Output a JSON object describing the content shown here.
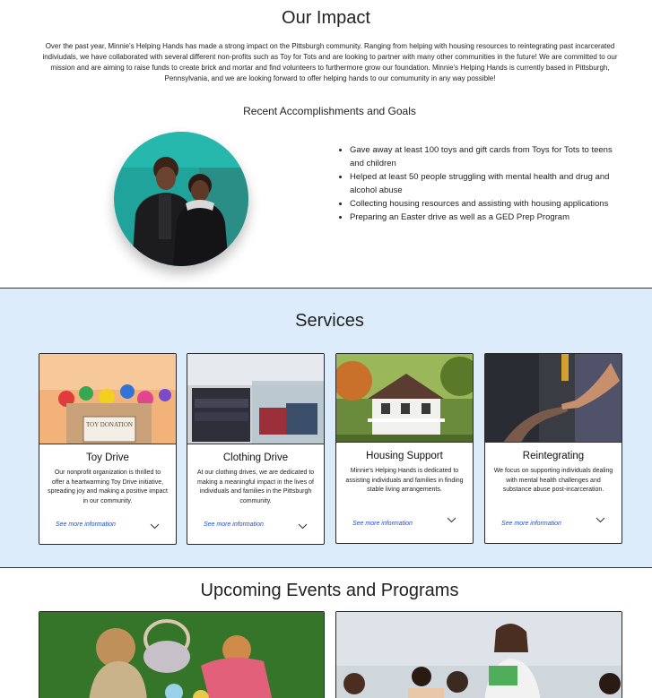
{
  "impact": {
    "title": "Our Impact",
    "intro": "Over the past year, Minnie's Helping Hands has made a strong impact on the Pittsburgh community. Ranging from helping with housing resources to reintegrating past incarcerated indiviudals, we have collaborated with several different non-profits such as Toy for Tots and are looking to partner with many other communities in the future! We are committed to our mission and are aiming to raise funds to create brick and mortar and find volunteers to furthermore grow our foundation. Minnie's Helping Hands is currently based in Pittsburgh, Pennsylvania, and we are looking forward to offer helping hands to our comumunity in any way possible!",
    "subtitle": "Recent Accomplishments and Goals",
    "goals": [
      "Gave away at least 100 toys and gift cards from Toys for Tots to teens and children",
      "Helped at least 50 people struggling with mental health and drug and alcohol abuse",
      "Collecting housing resources and assisting with housing applications",
      "Preparing an Easter drive as well as a GED Prep Program"
    ]
  },
  "services": {
    "title": "Services",
    "cards": [
      {
        "title": "Toy Drive",
        "description": "Our nonprofit organization is thrilled to offer a heartwarming Toy Drive initiative, spreading joy and making a positive impact in our community.",
        "more": "See more information",
        "box_label": "TOY DONATION"
      },
      {
        "title": "Clothing Drive",
        "description": "At our clothing drives, we are dedicated to making a meaningful impact in the lives of individuals and families in the Pittsburgh community.",
        "more": "See more information"
      },
      {
        "title": "Housing Support",
        "description": "Minnie's Helping Hands is dedicated to assisting individuals and families in finding stable living arrangements.",
        "more": "See more information"
      },
      {
        "title": "Reintegrating",
        "description": "We focus on supporting individuals dealing with mental health challenges and substance abuse post-incarceration.",
        "more": "See more information"
      }
    ]
  },
  "events": {
    "title": "Upcoming Events and Programs"
  },
  "colors": {
    "services_bg": "#dcecfb",
    "link": "#1f4fd6",
    "divider": "#333333"
  },
  "icons": [
    "chevron-down-icon"
  ]
}
